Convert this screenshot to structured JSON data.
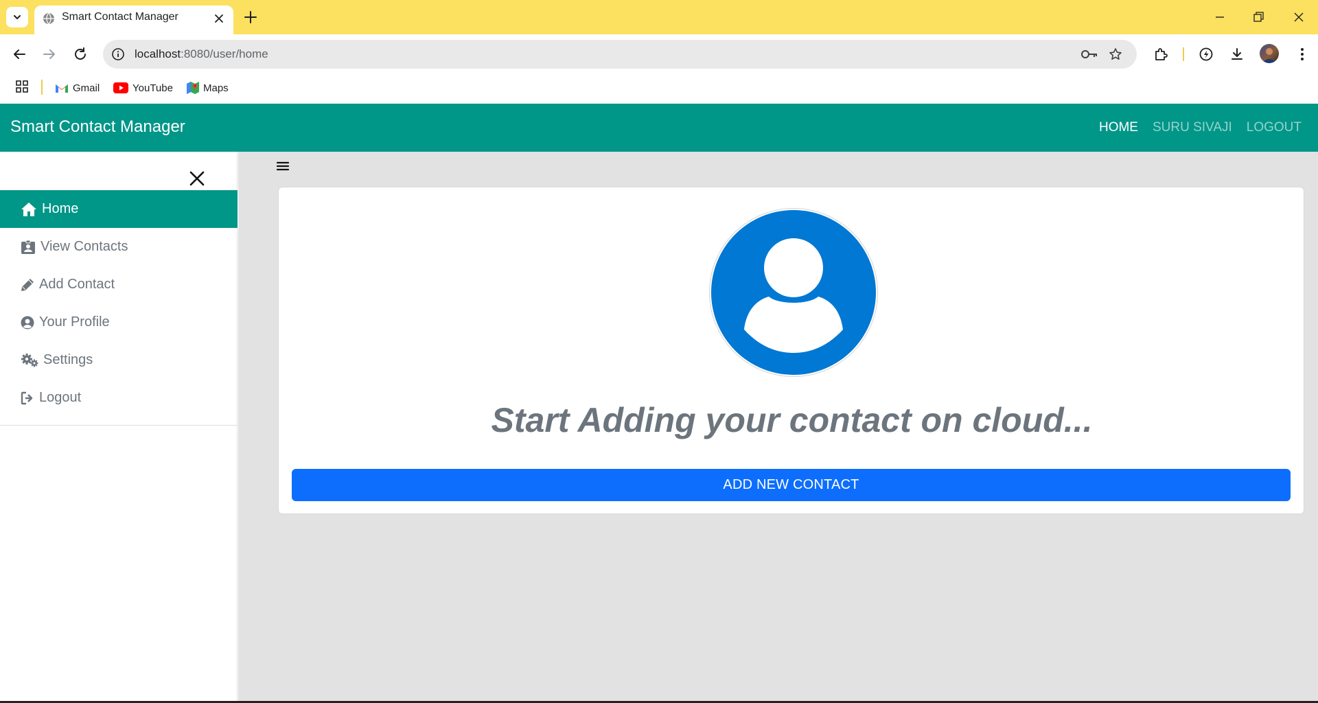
{
  "browser": {
    "tab_title": "Smart Contact Manager",
    "url_host": "localhost",
    "url_path": ":8080/user/home",
    "bookmarks": [
      {
        "label": "Gmail",
        "icon": "gmail-icon"
      },
      {
        "label": "YouTube",
        "icon": "youtube-icon"
      },
      {
        "label": "Maps",
        "icon": "maps-icon"
      }
    ]
  },
  "navbar": {
    "brand": "Smart Contact Manager",
    "links": [
      {
        "label": "HOME",
        "active": true
      },
      {
        "label": "SURU SIVAJI",
        "active": false
      },
      {
        "label": "LOGOUT",
        "active": false
      }
    ]
  },
  "sidebar": {
    "items": [
      {
        "label": "Home",
        "icon": "home-icon",
        "active": true
      },
      {
        "label": "View Contacts",
        "icon": "id-badge-icon",
        "active": false
      },
      {
        "label": "Add Contact",
        "icon": "pencil-icon",
        "active": false
      },
      {
        "label": "Your Profile",
        "icon": "user-circle-icon",
        "active": false
      },
      {
        "label": "Settings",
        "icon": "cogs-icon",
        "active": false
      },
      {
        "label": "Logout",
        "icon": "sign-out-icon",
        "active": false
      }
    ]
  },
  "main": {
    "headline": "Start Adding your contact on cloud...",
    "button_label": "ADD NEW CONTACT"
  },
  "colors": {
    "browser_frame": "#fce05f",
    "navbar": "#009688",
    "primary_button": "#0d6efd",
    "avatar_blue": "#0078d4",
    "main_bg": "#e2e2e2"
  }
}
